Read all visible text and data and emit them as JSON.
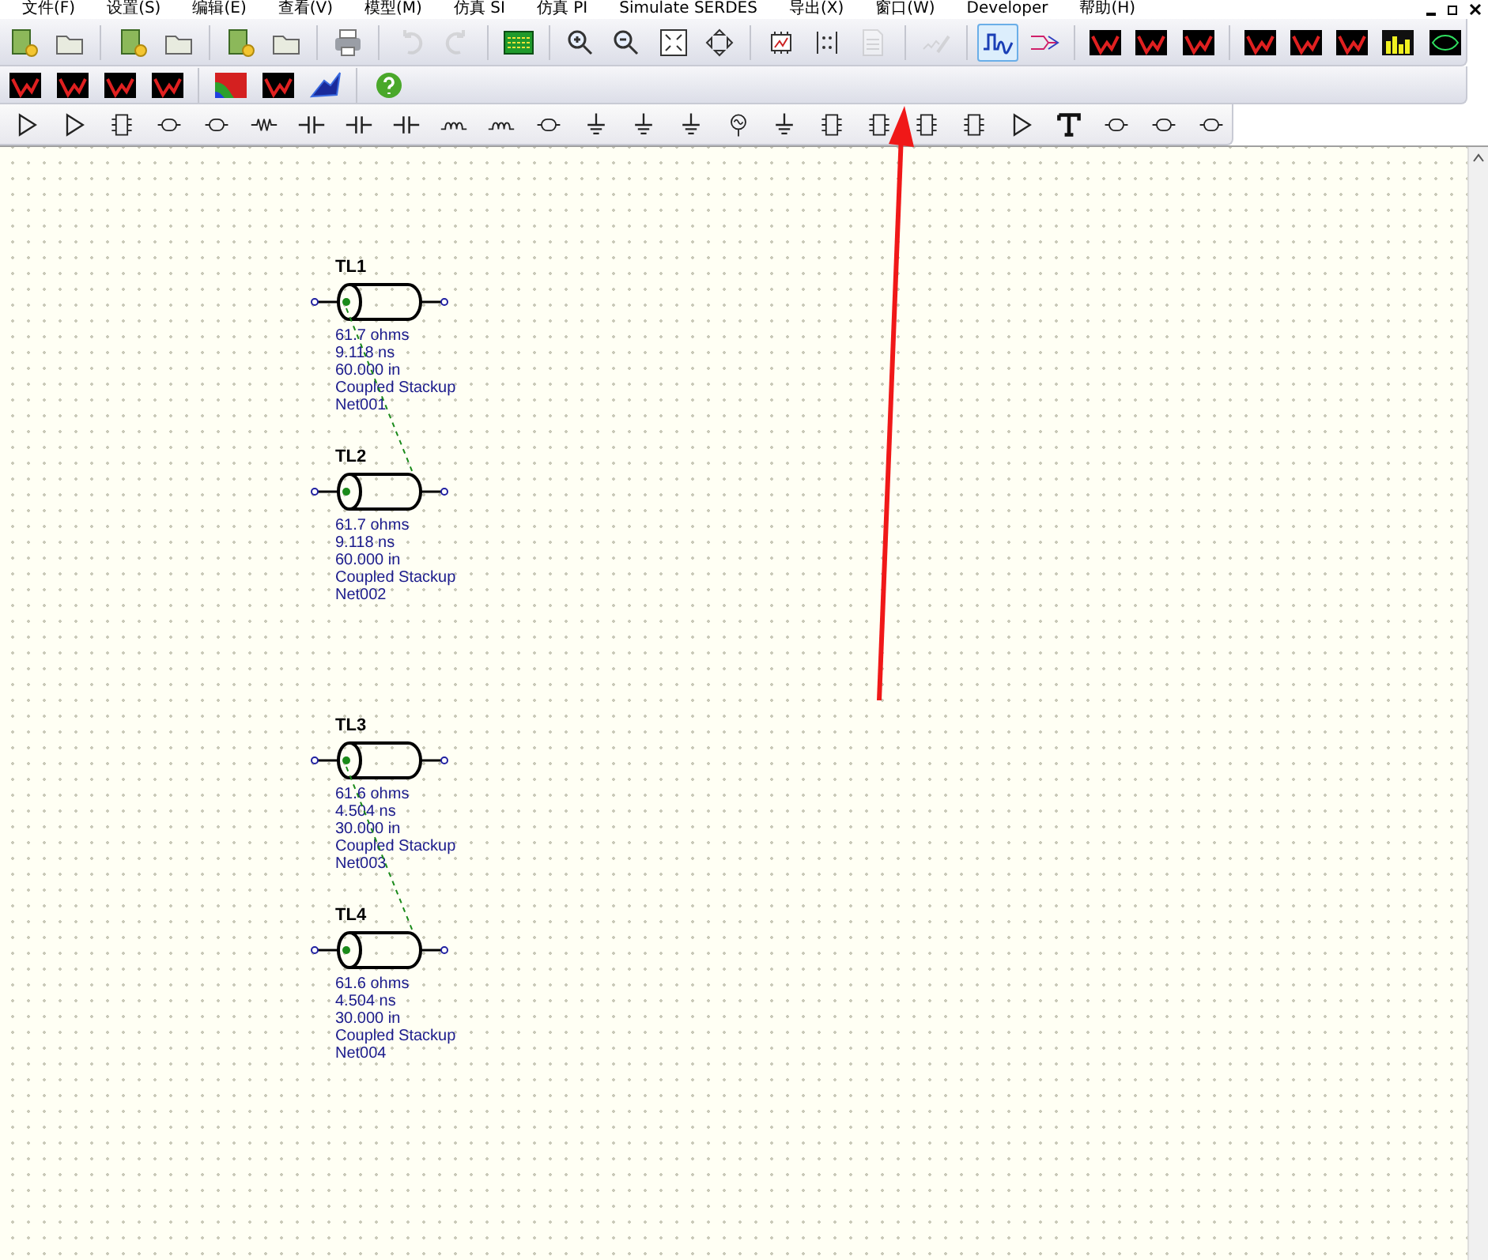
{
  "menu": [
    {
      "label": "文件(F)"
    },
    {
      "label": "设置(S)"
    },
    {
      "label": "编辑(E)"
    },
    {
      "label": "查看(V)"
    },
    {
      "label": "模型(M)"
    },
    {
      "label": "仿真 SI"
    },
    {
      "label": "仿真 PI"
    },
    {
      "label": "Simulate SERDES"
    },
    {
      "label": "导出(X)"
    },
    {
      "label": "窗口(W)"
    },
    {
      "label": "Developer"
    },
    {
      "label": "帮助(H)"
    }
  ],
  "toolbar_main": [
    {
      "kind": "newdoc",
      "selected": false,
      "disabled": false
    },
    {
      "kind": "open",
      "selected": false,
      "disabled": false
    },
    {
      "kind": "separator"
    },
    {
      "kind": "newdoc",
      "selected": false,
      "disabled": false
    },
    {
      "kind": "open",
      "selected": false,
      "disabled": false
    },
    {
      "kind": "separator"
    },
    {
      "kind": "newdoc",
      "selected": false,
      "disabled": false
    },
    {
      "kind": "open",
      "selected": false,
      "disabled": false
    },
    {
      "kind": "separator"
    },
    {
      "kind": "print",
      "selected": false,
      "disabled": false
    },
    {
      "kind": "separator"
    },
    {
      "kind": "undo",
      "selected": false,
      "disabled": true
    },
    {
      "kind": "redo",
      "selected": false,
      "disabled": true
    },
    {
      "kind": "separator"
    },
    {
      "kind": "board",
      "selected": false,
      "disabled": false
    },
    {
      "kind": "separator"
    },
    {
      "kind": "zoomin",
      "selected": false,
      "disabled": false
    },
    {
      "kind": "zoomout",
      "selected": false,
      "disabled": false
    },
    {
      "kind": "fit",
      "selected": false,
      "disabled": false
    },
    {
      "kind": "pan",
      "selected": false,
      "disabled": false
    },
    {
      "kind": "separator"
    },
    {
      "kind": "chip",
      "selected": false,
      "disabled": false
    },
    {
      "kind": "matrix",
      "selected": false,
      "disabled": false
    },
    {
      "kind": "page",
      "selected": false,
      "disabled": true
    },
    {
      "kind": "separator"
    },
    {
      "kind": "wand",
      "selected": false,
      "disabled": true
    },
    {
      "kind": "separator"
    },
    {
      "kind": "wave",
      "selected": true,
      "disabled": false
    },
    {
      "kind": "network",
      "selected": false,
      "disabled": false
    },
    {
      "kind": "separator"
    },
    {
      "kind": "scope",
      "selected": false,
      "disabled": false
    },
    {
      "kind": "scope",
      "selected": false,
      "disabled": false
    },
    {
      "kind": "scope",
      "selected": false,
      "disabled": false
    },
    {
      "kind": "separator"
    },
    {
      "kind": "scope",
      "selected": false,
      "disabled": false
    },
    {
      "kind": "scope",
      "selected": false,
      "disabled": false
    },
    {
      "kind": "scope",
      "selected": false,
      "disabled": false
    },
    {
      "kind": "bars",
      "selected": false,
      "disabled": false
    },
    {
      "kind": "eye",
      "selected": false,
      "disabled": false
    }
  ],
  "toolbar_analysis": [
    {
      "kind": "scope",
      "selected": false,
      "disabled": false
    },
    {
      "kind": "scope",
      "selected": false,
      "disabled": false
    },
    {
      "kind": "scope",
      "selected": false,
      "disabled": false
    },
    {
      "kind": "scope",
      "selected": false,
      "disabled": false
    },
    {
      "kind": "separator"
    },
    {
      "kind": "heatmap",
      "selected": false,
      "disabled": false
    },
    {
      "kind": "scope",
      "selected": false,
      "disabled": false
    },
    {
      "kind": "plot3d",
      "selected": false,
      "disabled": false
    },
    {
      "kind": "separator"
    },
    {
      "kind": "help",
      "selected": false,
      "disabled": false
    }
  ],
  "toolbar_parts": [
    {
      "kind": "buffer"
    },
    {
      "kind": "buffer"
    },
    {
      "kind": "ic"
    },
    {
      "kind": "connector"
    },
    {
      "kind": "connector"
    },
    {
      "kind": "resistor"
    },
    {
      "kind": "capacitor"
    },
    {
      "kind": "capacitor"
    },
    {
      "kind": "capacitor"
    },
    {
      "kind": "inductor"
    },
    {
      "kind": "inductor"
    },
    {
      "kind": "connector"
    },
    {
      "kind": "ground"
    },
    {
      "kind": "ground"
    },
    {
      "kind": "ground"
    },
    {
      "kind": "source"
    },
    {
      "kind": "ground"
    },
    {
      "kind": "ic"
    },
    {
      "kind": "ic"
    },
    {
      "kind": "ic"
    },
    {
      "kind": "ic"
    },
    {
      "kind": "buffer"
    },
    {
      "kind": "text"
    },
    {
      "kind": "connector"
    },
    {
      "kind": "connector"
    },
    {
      "kind": "connector"
    }
  ],
  "schematic": {
    "lines": [
      {
        "label": "TL1",
        "impedance": "61.7 ohms",
        "delay": "9.118 ns",
        "length": "60.000 in",
        "model": "Coupled Stackup",
        "net": "Net001"
      },
      {
        "label": "TL2",
        "impedance": "61.7 ohms",
        "delay": "9.118 ns",
        "length": "60.000 in",
        "model": "Coupled Stackup",
        "net": "Net002"
      },
      {
        "label": "TL3",
        "impedance": "61.6 ohms",
        "delay": "4.504 ns",
        "length": "30.000 in",
        "model": "Coupled Stackup",
        "net": "Net003"
      },
      {
        "label": "TL4",
        "impedance": "61.6 ohms",
        "delay": "4.504 ns",
        "length": "30.000 in",
        "model": "Coupled Stackup",
        "net": "Net004"
      }
    ]
  }
}
